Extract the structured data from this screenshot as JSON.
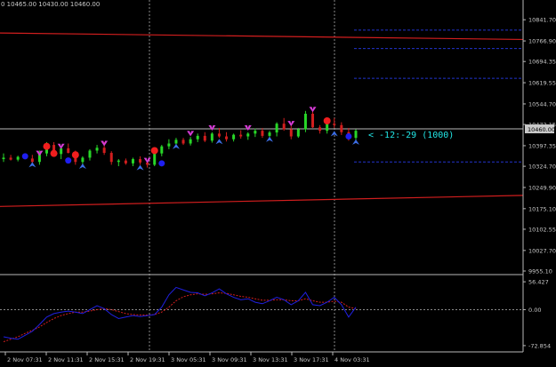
{
  "header": {
    "ohlc_text": "0 10465.00 10430.00 10460.00"
  },
  "chart_data": {
    "type": "candlestick",
    "title": "",
    "price_axis": {
      "ylim": [
        9955.1,
        10880.0
      ],
      "ticks": [
        "10841.70",
        "10766.90",
        "10694.35",
        "10619.55",
        "10544.70",
        "10472.15",
        "10397.35",
        "10324.70",
        "10249.90",
        "10175.10",
        "10102.55",
        "10027.70",
        "9955.10"
      ],
      "current_price": "10460.00"
    },
    "annotation": {
      "text": "< -12:-29 (1000)",
      "color": "#22e6e6"
    },
    "time_axis": {
      "labels": [
        "2 Nov 07:31",
        "2 Nov 11:31",
        "2 Nov 15:31",
        "2 Nov 19:31",
        "3 Nov 05:31",
        "3 Nov 09:31",
        "3 Nov 13:31",
        "3 Nov 17:31",
        "4 Nov 03:31"
      ]
    },
    "channel_lines": {
      "upper": {
        "y_start": 10795,
        "y_end": 10772,
        "color": "#d21e1e"
      },
      "lower": {
        "y_start": 10183,
        "y_end": 10222,
        "color": "#d21e1e"
      }
    },
    "dashed_levels": [
      10805,
      10740,
      10635,
      10340
    ],
    "candles": [
      [
        10350,
        10370,
        10340,
        10355
      ],
      [
        10355,
        10365,
        10345,
        10348
      ],
      [
        10348,
        10362,
        10342,
        10358
      ],
      [
        10358,
        10370,
        10350,
        10352
      ],
      [
        10352,
        10365,
        10330,
        10340
      ],
      [
        10340,
        10380,
        10330,
        10370
      ],
      [
        10370,
        10410,
        10360,
        10400
      ],
      [
        10400,
        10410,
        10360,
        10368
      ],
      [
        10368,
        10395,
        10350,
        10388
      ],
      [
        10388,
        10405,
        10370,
        10372
      ],
      [
        10372,
        10380,
        10330,
        10340
      ],
      [
        10340,
        10360,
        10330,
        10355
      ],
      [
        10355,
        10385,
        10345,
        10380
      ],
      [
        10380,
        10400,
        10370,
        10390
      ],
      [
        10390,
        10410,
        10365,
        10372
      ],
      [
        10372,
        10378,
        10330,
        10340
      ],
      [
        10340,
        10350,
        10325,
        10345
      ],
      [
        10345,
        10352,
        10330,
        10335
      ],
      [
        10335,
        10355,
        10325,
        10350
      ],
      [
        10350,
        10360,
        10330,
        10338
      ],
      [
        10338,
        10345,
        10320,
        10330
      ],
      [
        10330,
        10380,
        10325,
        10370
      ],
      [
        10370,
        10400,
        10360,
        10395
      ],
      [
        10395,
        10420,
        10385,
        10405
      ],
      [
        10405,
        10425,
        10395,
        10418
      ],
      [
        10418,
        10425,
        10400,
        10405
      ],
      [
        10405,
        10428,
        10398,
        10420
      ],
      [
        10420,
        10440,
        10410,
        10432
      ],
      [
        10432,
        10445,
        10410,
        10415
      ],
      [
        10415,
        10445,
        10408,
        10440
      ],
      [
        10440,
        10460,
        10425,
        10430
      ],
      [
        10430,
        10445,
        10412,
        10420
      ],
      [
        10420,
        10440,
        10412,
        10436
      ],
      [
        10436,
        10452,
        10422,
        10430
      ],
      [
        10430,
        10445,
        10418,
        10440
      ],
      [
        10440,
        10458,
        10428,
        10450
      ],
      [
        10450,
        10460,
        10425,
        10432
      ],
      [
        10432,
        10450,
        10420,
        10444
      ],
      [
        10444,
        10480,
        10430,
        10475
      ],
      [
        10475,
        10495,
        10450,
        10455
      ],
      [
        10455,
        10470,
        10420,
        10430
      ],
      [
        10430,
        10460,
        10425,
        10455
      ],
      [
        10455,
        10520,
        10445,
        10510
      ],
      [
        10510,
        10520,
        10460,
        10462
      ],
      [
        10462,
        10470,
        10440,
        10450
      ],
      [
        10450,
        10485,
        10440,
        10475
      ],
      [
        10475,
        10495,
        10460,
        10470
      ],
      [
        10470,
        10480,
        10435,
        10445
      ],
      [
        10445,
        10460,
        10415,
        10425
      ],
      [
        10425,
        10455,
        10415,
        10450
      ]
    ],
    "up_color": "#28d628",
    "down_color": "#d21e1e",
    "sell_markers": [
      [
        5,
        10370
      ],
      [
        8,
        10395
      ],
      [
        14,
        10405
      ],
      [
        20,
        10345
      ],
      [
        26,
        10440
      ],
      [
        29,
        10460
      ],
      [
        34,
        10460
      ],
      [
        40,
        10475
      ],
      [
        43,
        10525
      ]
    ],
    "buy_markers": [
      [
        4,
        10330
      ],
      [
        11,
        10325
      ],
      [
        19,
        10320
      ],
      [
        24,
        10395
      ],
      [
        30,
        10412
      ],
      [
        37,
        10420
      ],
      [
        46,
        10440
      ],
      [
        49,
        10410
      ]
    ],
    "red_dots": [
      [
        6,
        10395
      ],
      [
        7,
        10370
      ],
      [
        10,
        10365
      ],
      [
        21,
        10380
      ],
      [
        45,
        10485
      ]
    ],
    "blue_dots": [
      [
        3,
        10360
      ],
      [
        9,
        10345
      ],
      [
        22,
        10335
      ],
      [
        48,
        10430
      ]
    ],
    "indicator": {
      "ticks": [
        "56.427",
        "0.00",
        "-72.854"
      ],
      "ylim": [
        -82,
        62
      ],
      "zero": 0,
      "main": [
        -55,
        -58,
        -60,
        -52,
        -44,
        -30,
        -15,
        -8,
        -5,
        -3,
        -5,
        -8,
        0,
        8,
        2,
        -10,
        -18,
        -15,
        -12,
        -14,
        -12,
        -10,
        5,
        30,
        45,
        40,
        35,
        34,
        28,
        34,
        42,
        32,
        25,
        20,
        22,
        15,
        12,
        18,
        25,
        20,
        10,
        18,
        35,
        10,
        8,
        15,
        25,
        10,
        -15,
        5
      ],
      "signal": [
        -65,
        -60,
        -55,
        -48,
        -42,
        -35,
        -26,
        -18,
        -12,
        -8,
        -5,
        -5,
        -3,
        0,
        2,
        0,
        -4,
        -8,
        -10,
        -11,
        -11,
        -10,
        -5,
        5,
        18,
        26,
        30,
        32,
        31,
        32,
        34,
        33,
        30,
        27,
        25,
        22,
        19,
        19,
        20,
        20,
        18,
        18,
        22,
        18,
        15,
        15,
        17,
        15,
        5,
        2
      ],
      "main_color": "#2020e0",
      "signal_color": "#d21e1e"
    }
  }
}
